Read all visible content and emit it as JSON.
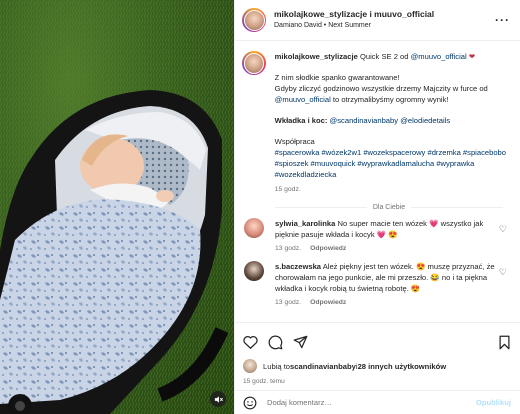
{
  "header": {
    "username": "mikolajkowe_stylizacje i muuvo_official",
    "audio": "Damiano David • Next Summer",
    "more_icon": "more-dots-icon"
  },
  "caption": {
    "username": "mikolajkowe_stylizacje",
    "text_pre": " Quick SE 2 od ",
    "mention": "@muuvo_official",
    "emoji": "❤",
    "line1": "Z nim słodkie spanko gwarantowane!",
    "line2": "Gdyby zliczyć godzinowo wszystkie drzemy Majczity w furce od",
    "line3_mention": "@muuvo_official",
    "line3_rest": " to otrzymalibyśmy ogromny wynik!",
    "credits_label": "Wkładka i koc: ",
    "credits_mention1": "@scandinavianbaby",
    "credits_mention2": "@elodiedetails",
    "coop_label": "Współpraca",
    "hashtags": "#spacerowka #wózek2w1 #wozekspacerowy #drzemka #spiacebobo #spioszek #muuvoquick #wyprawkadlamalucha #wyprawka #wozekdladziecka",
    "time": "15 godz."
  },
  "for_you_label": "Dla Ciebie",
  "comments": [
    {
      "username": "sylwia_karolinka",
      "text": " No super macie ten wózek 💗 wszystko jak pięknie pasuje wkłada i kocyk 💗 😍",
      "time": "13 godz.",
      "reply": "Odpowiedz"
    },
    {
      "username": "s.baczewska",
      "text": " Ależ piękny jest ten wózek. 😍 muszę przyznać, że chorowałam na jego punkcie, ale mi przeszło. 😂 no i ta piękna wkładka i kocyk robią tu świetną robotę. 😍",
      "time": "13 godz.",
      "reply": "Odpowiedz"
    }
  ],
  "likes": {
    "prefix": "Lubią to ",
    "user": "scandinavianbaby",
    "mid": " i ",
    "count": "28 innych użytkowników"
  },
  "date": "15 godz. temu",
  "add_comment": {
    "placeholder": "Dodaj komentarz…",
    "publish": "Opublikuj"
  },
  "colors": {
    "link": "#00376b",
    "muted": "#737373",
    "publish_disabled": "#b2dffc",
    "heart": "#ed4956"
  }
}
